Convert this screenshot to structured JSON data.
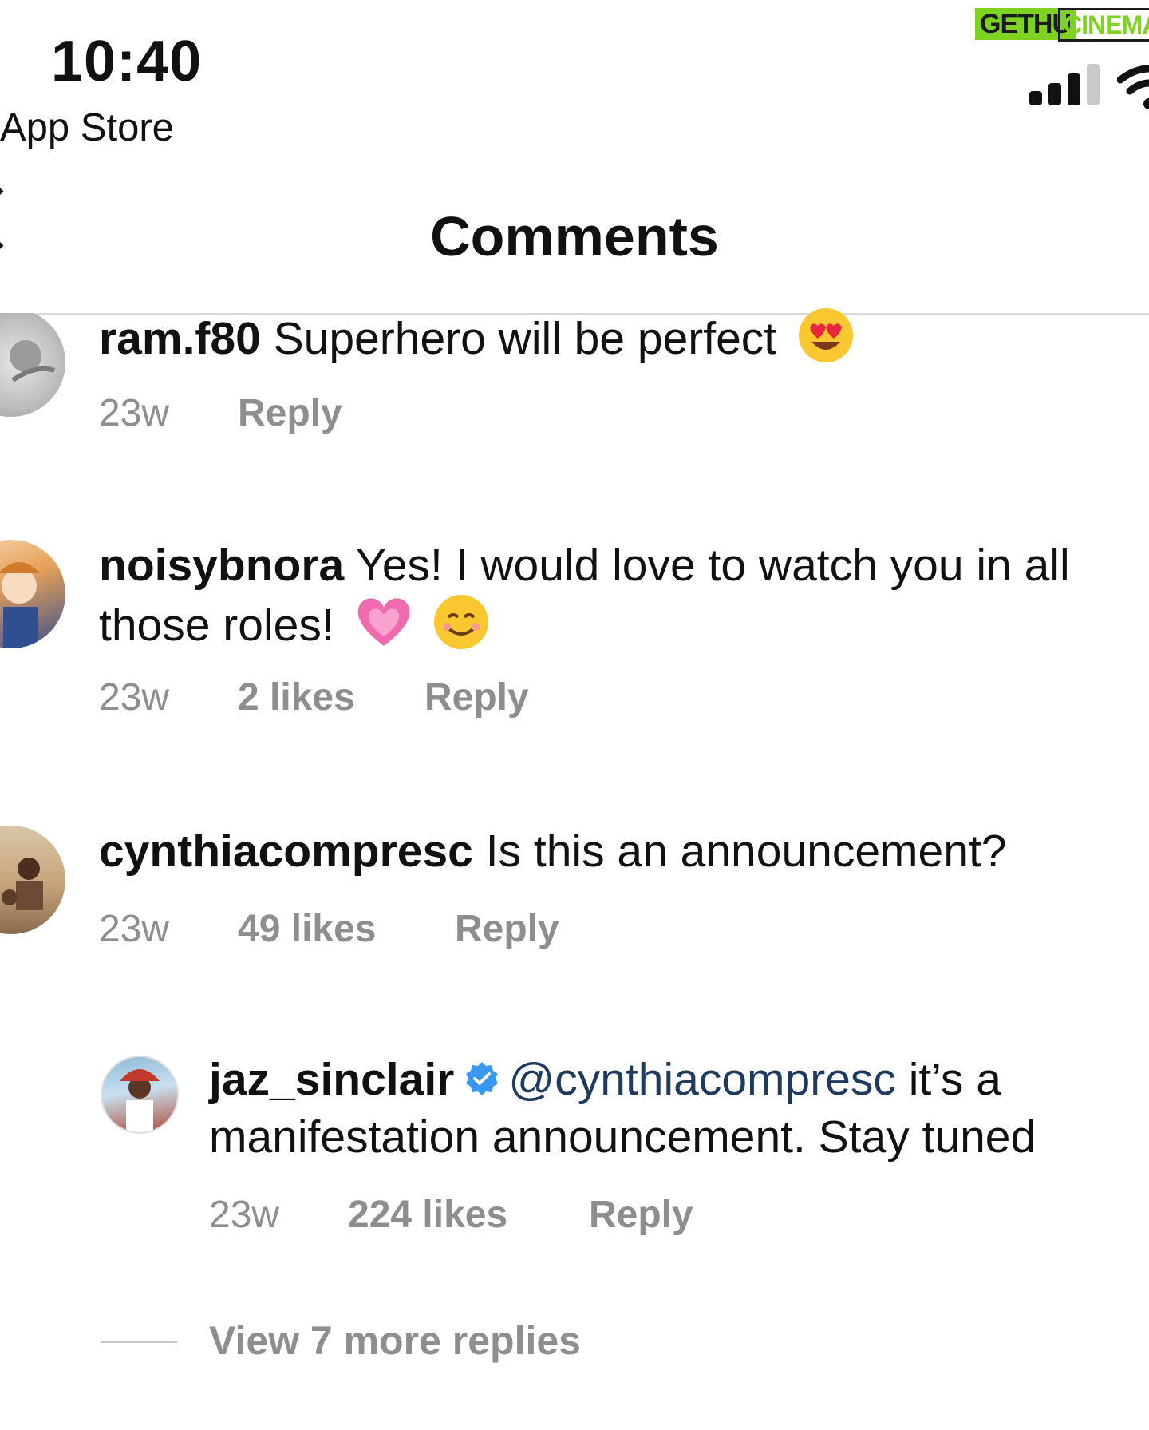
{
  "status_bar": {
    "time": "10:40",
    "back_app_label": "App Store"
  },
  "watermark": {
    "left": "GETHU",
    "right": "CINEMA"
  },
  "header": {
    "title": "Comments"
  },
  "comments": [
    {
      "username": "ram.f80",
      "text": "Superhero will be perfect",
      "emojis": [
        "smiling-face-with-heart-eyes"
      ],
      "age": "23w",
      "likes": "",
      "reply_label": "Reply"
    },
    {
      "username": "noisybnora",
      "text_line1": "Yes! I would love to watch you in all",
      "text_line2": "those roles!",
      "emojis": [
        "growing-heart",
        "smiling-face"
      ],
      "age": "23w",
      "likes": "2 likes",
      "reply_label": "Reply"
    },
    {
      "username": "cynthiacompresc",
      "text": "Is this an announcement?",
      "age": "23w",
      "likes": "49 likes",
      "reply_label": "Reply"
    }
  ],
  "reply": {
    "username": "jaz_sinclair",
    "verified": true,
    "mention": "@cynthiacompresc",
    "text_line1": "it’s a",
    "text_line2": "manifestation announcement. Stay tuned",
    "age": "23w",
    "likes": "224 likes",
    "reply_label": "Reply"
  },
  "view_more_replies": "View 7 more replies",
  "colors": {
    "text": "#111111",
    "meta": "#8e8e8e",
    "mention": "#1f3a5f",
    "verified": "#3897f0",
    "divider": "#dbdbdb"
  }
}
